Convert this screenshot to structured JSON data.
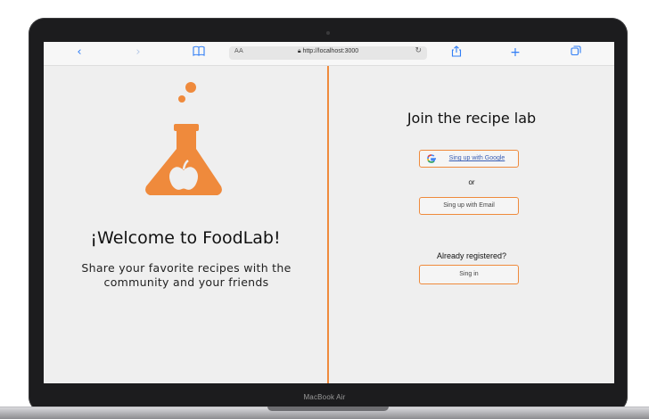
{
  "device": {
    "label": "MacBook Air"
  },
  "browser": {
    "back_icon": "chevron-left-icon",
    "forward_icon": "chevron-right-icon",
    "bookmarks_icon": "book-icon",
    "text_size": "AA",
    "url": "http://localhost:3000",
    "reload_icon": "reload-icon",
    "share_icon": "share-icon",
    "new_tab_icon": "plus-icon",
    "tabs_icon": "tabs-icon"
  },
  "left": {
    "title": "¡Welcome to FoodLab!",
    "tagline": "Share your favorite recipes with the community and your friends"
  },
  "right": {
    "heading": "Join the recipe lab",
    "google_button": "Sing up with Google",
    "or_text": "or",
    "email_button": "Sing up with Email",
    "already_text": "Already registered?",
    "signin_button": "Sing in"
  },
  "colors": {
    "accent": "#ef8a3c",
    "background": "#efefef",
    "browser_blue": "#2f7df6"
  }
}
